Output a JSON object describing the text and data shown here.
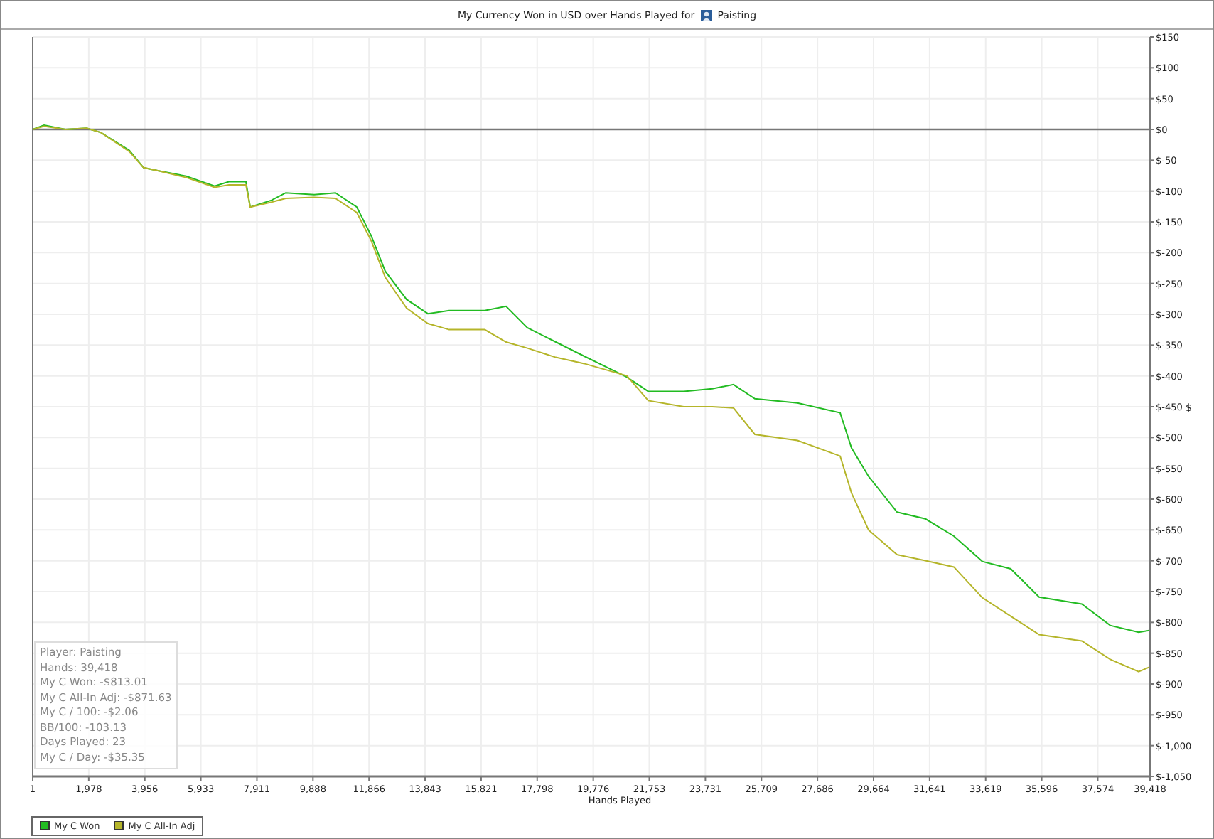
{
  "title": {
    "text": "My Currency Won in USD over Hands Played for",
    "player": "Paisting"
  },
  "chart_data": {
    "type": "line",
    "grid": true,
    "xlabel": "Hands Played",
    "ylabel": "$",
    "xlim": [
      1,
      39418
    ],
    "ylim": [
      -1050,
      150
    ],
    "x": [
      1,
      402,
      1154,
      1907,
      2408,
      3411,
      3913,
      4414,
      5417,
      6420,
      6922,
      7524,
      7674,
      8426,
      8928,
      9931,
      10683,
      11435,
      11937,
      12438,
      13191,
      13943,
      14695,
      15949,
      16701,
      17453,
      18456,
      19459,
      20964,
      21716,
      22970,
      23973,
      24725,
      25477,
      26982,
      28486,
      28887,
      29489,
      30492,
      31495,
      32498,
      33500,
      34504,
      35506,
      37011,
      38014,
      39017,
      39418
    ],
    "series": [
      {
        "name": "My C Won",
        "color": "#22bb22",
        "values": [
          0,
          7,
          0,
          2,
          -5,
          -34,
          -62,
          -67,
          -76,
          -92,
          -85,
          -85,
          -126,
          -115,
          -103,
          -106,
          -103,
          -126,
          -172,
          -230,
          -276,
          -299,
          -294,
          -294,
          -287,
          -322,
          -345,
          -368,
          -402,
          -425,
          -425,
          -421,
          -414,
          -437,
          -444,
          -460,
          -517,
          -563,
          -621,
          -632,
          -660,
          -701,
          -713,
          -759,
          -770,
          -805,
          -816,
          -813
        ]
      },
      {
        "name": "My C All-In Adj",
        "color": "#b5b52a",
        "values": [
          0,
          5,
          0,
          2,
          -5,
          -36,
          -62,
          -67,
          -78,
          -94,
          -90,
          -90,
          -126,
          -118,
          -112,
          -110,
          -112,
          -135,
          -180,
          -240,
          -290,
          -315,
          -325,
          -325,
          -345,
          -355,
          -370,
          -380,
          -400,
          -440,
          -450,
          -450,
          -452,
          -495,
          -505,
          -530,
          -590,
          -650,
          -690,
          -700,
          -710,
          -760,
          -790,
          -820,
          -830,
          -860,
          -880,
          -872
        ]
      }
    ],
    "xticks": [
      {
        "value": 1,
        "label": "1"
      },
      {
        "value": 1978,
        "label": "1,978"
      },
      {
        "value": 3956,
        "label": "3,956"
      },
      {
        "value": 5933,
        "label": "5,933"
      },
      {
        "value": 7911,
        "label": "7,911"
      },
      {
        "value": 9888,
        "label": "9,888"
      },
      {
        "value": 11866,
        "label": "11,866"
      },
      {
        "value": 13843,
        "label": "13,843"
      },
      {
        "value": 15821,
        "label": "15,821"
      },
      {
        "value": 17798,
        "label": "17,798"
      },
      {
        "value": 19776,
        "label": "19,776"
      },
      {
        "value": 21753,
        "label": "21,753"
      },
      {
        "value": 23731,
        "label": "23,731"
      },
      {
        "value": 25709,
        "label": "25,709"
      },
      {
        "value": 27686,
        "label": "27,686"
      },
      {
        "value": 29664,
        "label": "29,664"
      },
      {
        "value": 31641,
        "label": "31,641"
      },
      {
        "value": 33619,
        "label": "33,619"
      },
      {
        "value": 35596,
        "label": "35,596"
      },
      {
        "value": 37574,
        "label": "37,574"
      },
      {
        "value": 39418,
        "label": "39,418"
      }
    ],
    "yticks": [
      {
        "value": 150,
        "label": "$150"
      },
      {
        "value": 100,
        "label": "$100"
      },
      {
        "value": 50,
        "label": "$50"
      },
      {
        "value": 0,
        "label": "$0"
      },
      {
        "value": -50,
        "label": "$-50"
      },
      {
        "value": -100,
        "label": "$-100"
      },
      {
        "value": -150,
        "label": "$-150"
      },
      {
        "value": -200,
        "label": "$-200"
      },
      {
        "value": -250,
        "label": "$-250"
      },
      {
        "value": -300,
        "label": "$-300"
      },
      {
        "value": -350,
        "label": "$-350"
      },
      {
        "value": -400,
        "label": "$-400"
      },
      {
        "value": -450,
        "label": "$-450"
      },
      {
        "value": -500,
        "label": "$-500"
      },
      {
        "value": -550,
        "label": "$-550"
      },
      {
        "value": -600,
        "label": "$-600"
      },
      {
        "value": -650,
        "label": "$-650"
      },
      {
        "value": -700,
        "label": "$-700"
      },
      {
        "value": -750,
        "label": "$-750"
      },
      {
        "value": -800,
        "label": "$-800"
      },
      {
        "value": -850,
        "label": "$-850"
      },
      {
        "value": -900,
        "label": "$-900"
      },
      {
        "value": -950,
        "label": "$-950"
      },
      {
        "value": -1000,
        "label": "$-1,000"
      },
      {
        "value": -1050,
        "label": "$-1,050"
      }
    ]
  },
  "stats": [
    "Player: Paisting",
    "Hands: 39,418",
    "My C Won: -$813.01",
    "My C All-In Adj: -$871.63",
    "My C / 100: -$2.06",
    "BB/100: -103.13",
    "Days Played: 23",
    "My C / Day: -$35.35"
  ]
}
